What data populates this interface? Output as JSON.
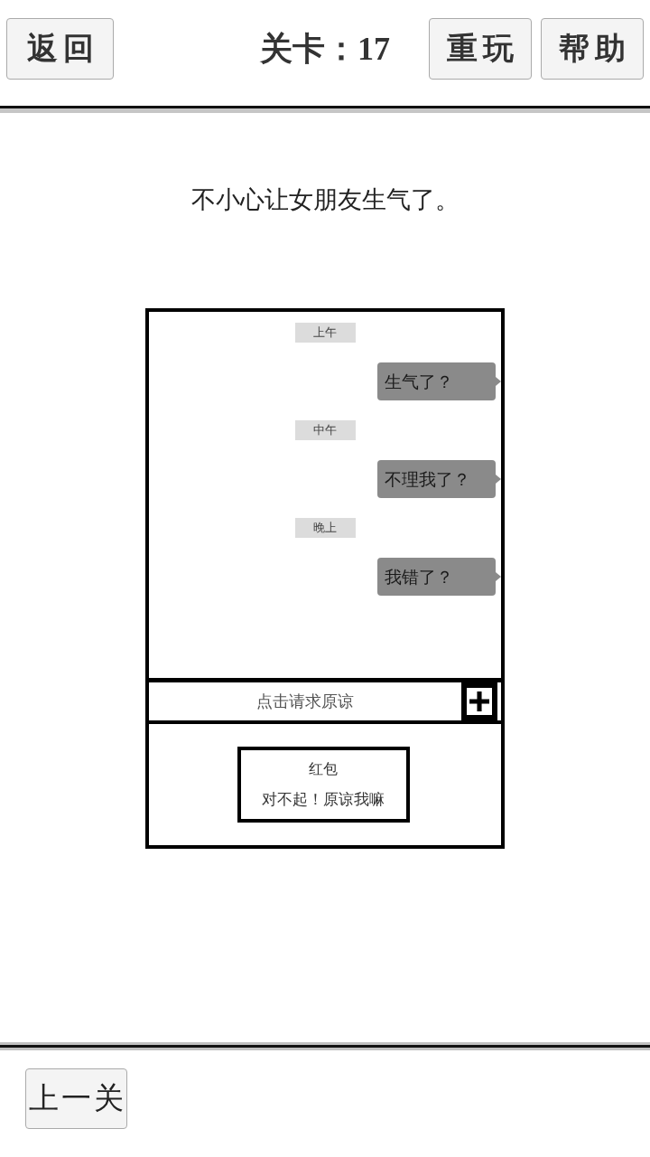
{
  "header": {
    "back_button": "返回",
    "level_title": "关卡：17",
    "actions": [
      "重玩",
      "帮助"
    ]
  },
  "prompt": "不小心让女朋友生气了。",
  "chat": {
    "messages": [
      {
        "kind": "time",
        "text": "上午"
      },
      {
        "kind": "bubble",
        "text": "生气了？"
      },
      {
        "kind": "time",
        "text": "中午"
      },
      {
        "kind": "bubble",
        "text": "不理我了？"
      },
      {
        "kind": "time",
        "text": "晚上"
      },
      {
        "kind": "bubble",
        "text": "我错了？"
      }
    ]
  },
  "input_bar": {
    "label": "点击请求原谅"
  },
  "attachment_panel": {
    "cards": [
      {
        "title": "红包",
        "subtitle": "对不起！原谅我嘛"
      }
    ]
  },
  "footer": {
    "prev_button": "上一关"
  }
}
